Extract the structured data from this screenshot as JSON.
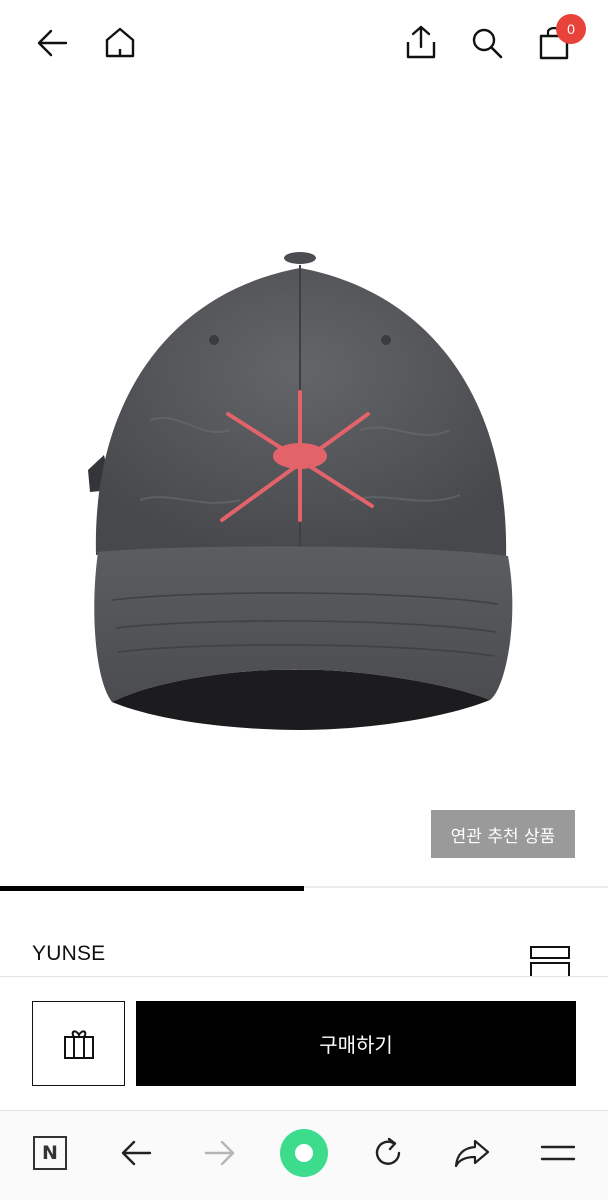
{
  "header": {
    "cart_count": "0"
  },
  "product": {
    "related_label": "연관 추천 상품",
    "brand": "YUNSE",
    "gallery_progress": 0.5
  },
  "purchase": {
    "buy_label": "구매하기"
  },
  "browser": {
    "logo_letter": "N"
  },
  "colors": {
    "badge": "#e8433a",
    "primary_button": "#000000",
    "related_button": "#9a9a9a",
    "browser_home": "#3ddc8c",
    "cap_body": "#56585b",
    "star_embroidery": "#e3636a"
  }
}
